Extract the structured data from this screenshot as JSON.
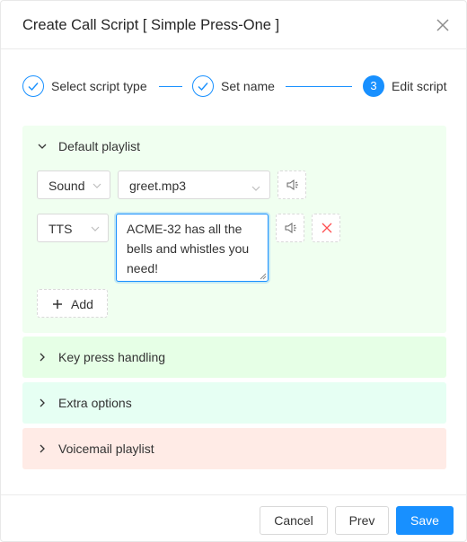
{
  "dialog": {
    "title": "Create Call Script [ Simple Press-One ]"
  },
  "steps": [
    {
      "label": "Select script type",
      "status": "done"
    },
    {
      "label": "Set name",
      "status": "done"
    },
    {
      "label": "Edit script",
      "status": "active",
      "number": "3"
    }
  ],
  "panels": {
    "default_playlist": {
      "title": "Default playlist",
      "expanded": true,
      "bg": "#f0fff0",
      "rows": [
        {
          "type": "Sound",
          "value": "greet.mp3"
        },
        {
          "type": "TTS",
          "value": "ACME-32 has all the bells and whistles you need!"
        }
      ],
      "add_label": "Add"
    },
    "key_press": {
      "title": "Key press handling",
      "bg": "#e6ffe6"
    },
    "extra": {
      "title": "Extra options",
      "bg": "#e6fff3"
    },
    "voicemail": {
      "title": "Voicemail playlist",
      "bg": "#ffebe6"
    }
  },
  "footer": {
    "cancel": "Cancel",
    "prev": "Prev",
    "save": "Save"
  },
  "colors": {
    "primary": "#1890ff",
    "danger": "#ff4d4f"
  },
  "icons": {
    "close": "close-icon",
    "chevron_down": "chevron-down-icon",
    "chevron_right": "chevron-right-icon",
    "check": "check-icon",
    "speaker": "speaker-icon",
    "delete": "close-icon",
    "add": "plus-icon"
  }
}
